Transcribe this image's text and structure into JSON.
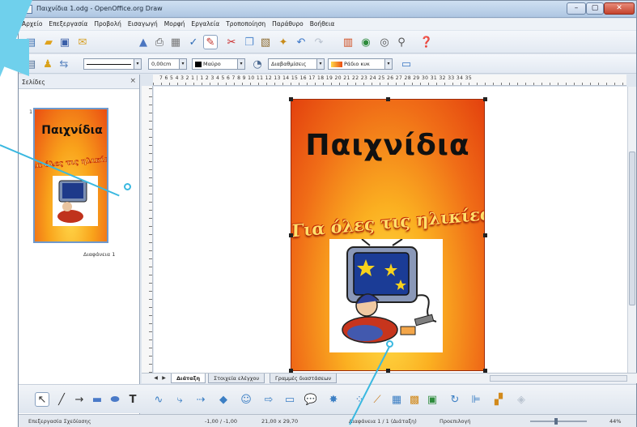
{
  "window": {
    "title": "Παιχνίδια 1.odg - OpenOffice.org Draw",
    "controls": {
      "minimize": "–",
      "maximize": "▢",
      "close": "✕"
    }
  },
  "menu": [
    "Αρχείο",
    "Επεξεργασία",
    "Προβολή",
    "Εισαγωγή",
    "Μορφή",
    "Εργαλεία",
    "Τροποποίηση",
    "Παράθυρο",
    "Βοήθεια"
  ],
  "line_toolbar": {
    "line_width": "0,00cm",
    "color": "Μαύρο",
    "area_style": "Διαβαθμίσεις",
    "area_fill": "Ράδιο κυκ"
  },
  "slides_panel": {
    "title": "Σελίδες",
    "close": "×",
    "thumb_number": "1",
    "thumb_caption": "Διαφάνεια 1"
  },
  "ruler": {
    "top_numbers": "7 6 5 4 3 2 1 | 1 2 3 4 5 6 7 8 9 10 11 12 13 14 15 16 17 18 19 20 21 22 23 24 25 26 27 28 29 30 31 32 33 34 35"
  },
  "slide": {
    "title": "Παιχνίδια",
    "subtitle": "Για όλες τις ηλικίες!"
  },
  "sheet_tabs": [
    "Διάταξη",
    "Στοιχεία ελέγχου",
    "Γραμμές διαστάσεων"
  ],
  "status": {
    "info": "Επεξεργασία Σχεδίασης",
    "position": "-1,00 / -1,00",
    "size": "21,00 x 29,70",
    "page": "Διαφάνεια 1 / 1 (Διάταξη)",
    "style": "Προεπιλογή",
    "zoom": "44%"
  },
  "colors": {
    "callout": "#6fd0ec",
    "slide_orange": "#f06d17",
    "slide_yellow": "#ffe04a"
  },
  "icons": [
    "new-icon",
    "open-icon",
    "save-icon",
    "mail-icon",
    "print-icon",
    "spellcheck-icon",
    "cut-icon",
    "copy-icon",
    "paste-icon",
    "undo-icon",
    "redo-icon",
    "chart-icon",
    "navigator-icon",
    "zoom-icon",
    "help-icon",
    "pointer-icon",
    "line-icon",
    "arrow-icon",
    "rectangle-icon",
    "ellipse-icon",
    "text-icon",
    "curve-icon",
    "connector-icon",
    "basic-shapes-icon",
    "symbol-shapes-icon",
    "block-arrows-icon",
    "flowchart-icon",
    "callouts-icon",
    "stars-icon",
    "points-icon",
    "fontwork-icon",
    "image-icon",
    "3d-icon"
  ]
}
